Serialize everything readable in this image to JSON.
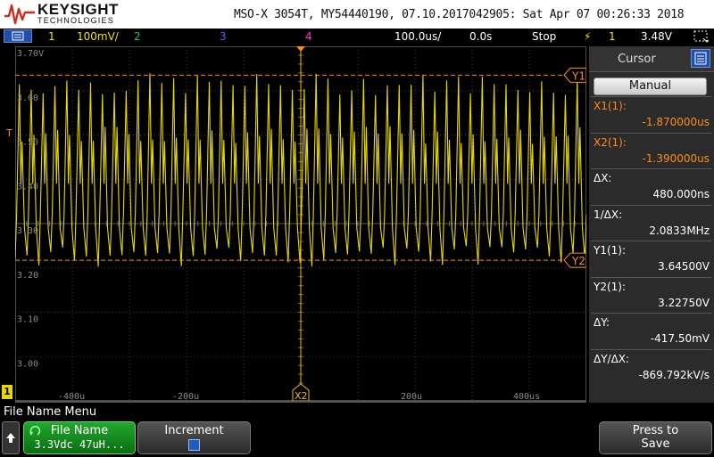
{
  "header": {
    "brand": "KEYSIGHT",
    "brand_sub": "TECHNOLOGIES",
    "scope_info": "MSO-X 3054T, MY54440190, 07.10.2017042905: Sat Apr 07 00:26:33 2018"
  },
  "channel_bar": {
    "ch1_num": "1",
    "ch1_scale": "100mV/",
    "ch2_num": "2",
    "ch3_num": "3",
    "ch4_num": "4",
    "timebase": "100.0us/",
    "delay": "0.0s",
    "run_state": "Stop",
    "trigger_source": "1",
    "trigger_level": "3.48V"
  },
  "graticule": {
    "y_labels": [
      "3.70V",
      "3.60",
      "3.50",
      "3.40",
      "3.30",
      "3.20",
      "3.10",
      "3.00"
    ],
    "x_labels": [
      "-400u",
      "-200u",
      "200u",
      "400us"
    ],
    "trigger_marker": "T",
    "ground_marker": "1",
    "cursor_y1_label": "Y1",
    "cursor_y2_label": "Y2",
    "cursor_x2_label": "X2",
    "trace_color": "#e8d800",
    "cursor_color": "#ff8c1a"
  },
  "right_panel": {
    "title": "Cursor",
    "mode_button": "Manual",
    "measurements": [
      {
        "label": "X1(1):",
        "value": "-1.870000us",
        "highlight": true
      },
      {
        "label": "X2(1):",
        "value": "-1.390000us",
        "highlight": true
      },
      {
        "label": "ΔX:",
        "value": "480.000ns",
        "highlight": false
      },
      {
        "label": "1/ΔX:",
        "value": "2.0833MHz",
        "highlight": false
      },
      {
        "label": "Y1(1):",
        "value": "3.64500V",
        "highlight": false
      },
      {
        "label": "Y2(1):",
        "value": "3.22750V",
        "highlight": false
      },
      {
        "label": "ΔY:",
        "value": "-417.50mV",
        "highlight": false
      },
      {
        "label": "ΔY/ΔX:",
        "value": "-869.792kV/s",
        "highlight": false
      }
    ]
  },
  "softkeys": {
    "menu_title": "File Name Menu",
    "file_name_label": "File Name",
    "file_name_value": "3.3Vdc 47uH...",
    "increment_label": "Increment",
    "save_label_line1": "Press to",
    "save_label_line2": "Save"
  }
}
